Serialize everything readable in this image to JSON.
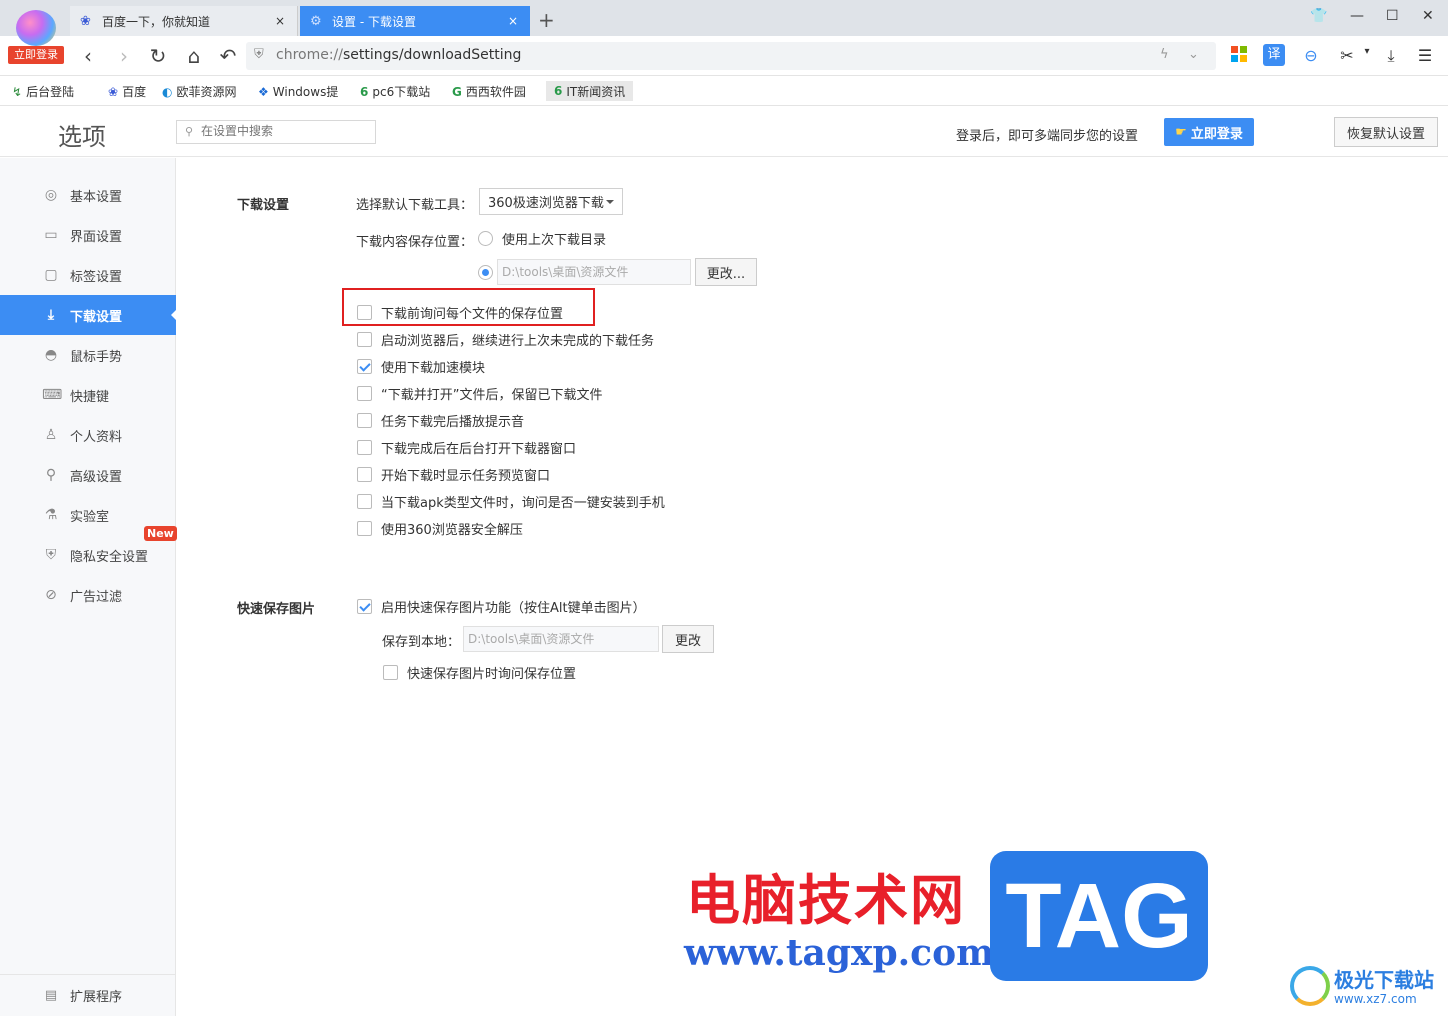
{
  "browser": {
    "login_badge": "立即登录",
    "tabs": [
      {
        "title": "百度一下，你就知道",
        "icon": "baidu-paw-icon",
        "close": "×"
      },
      {
        "title": "设置 - 下载设置",
        "icon": "gear-icon",
        "close": "×"
      }
    ],
    "new_tab": "+",
    "address": {
      "scheme": "chrome://",
      "host_path": "settings/downloadSetting"
    },
    "bookmarks": [
      {
        "label": "后台登陆",
        "icon_char": "↯"
      },
      {
        "label": "百度",
        "icon_char": "❀"
      },
      {
        "label": "欧菲资源网",
        "icon_char": "◐"
      },
      {
        "label": "Windows提",
        "icon_char": "❖"
      },
      {
        "label": "pc6下载站",
        "icon_char": "6"
      },
      {
        "label": "西西软件园",
        "icon_char": "G"
      },
      {
        "label": "IT新闻资讯",
        "icon_char": "6"
      }
    ],
    "toolbar_translate": "译"
  },
  "settings": {
    "title": "选项",
    "search_placeholder": "在设置中搜索",
    "login_tip": "登录后，即可多端同步您的设置",
    "login_button": "立即登录",
    "restore_button": "恢复默认设置",
    "sidebar": [
      {
        "label": "基本设置",
        "icon": "◎"
      },
      {
        "label": "界面设置",
        "icon": "▭"
      },
      {
        "label": "标签设置",
        "icon": "▢"
      },
      {
        "label": "下载设置",
        "icon": "⤓"
      },
      {
        "label": "鼠标手势",
        "icon": "◓"
      },
      {
        "label": "快捷键",
        "icon": "⌨"
      },
      {
        "label": "个人资料",
        "icon": "♙"
      },
      {
        "label": "高级设置",
        "icon": "⚲"
      },
      {
        "label": "实验室",
        "icon": "⚗"
      },
      {
        "label": "隐私安全设置",
        "icon": "⛨"
      },
      {
        "label": "广告过滤",
        "icon": "⊘"
      }
    ],
    "new_badge": "New",
    "extensions": {
      "label": "扩展程序",
      "icon": "▤"
    },
    "download": {
      "section_title": "下载设置",
      "tool_label": "选择默认下载工具：",
      "tool_value": "360极速浏览器下载",
      "location_label": "下载内容保存位置：",
      "use_last_dir": "使用上次下载目录",
      "custom_path": "D:\\tools\\桌面\\资源文件",
      "change_button": "更改...",
      "options": [
        {
          "label": "下载前询问每个文件的保存位置",
          "checked": false
        },
        {
          "label": "启动浏览器后，继续进行上次未完成的下载任务",
          "checked": false
        },
        {
          "label": "使用下载加速模块",
          "checked": true
        },
        {
          "label": "“下载并打开”文件后，保留已下载文件",
          "checked": false
        },
        {
          "label": "任务下载完后播放提示音",
          "checked": false
        },
        {
          "label": "下载完成后在后台打开下载器窗口",
          "checked": false
        },
        {
          "label": "开始下载时显示任务预览窗口",
          "checked": false
        },
        {
          "label": "当下载apk类型文件时，询问是否一键安装到手机",
          "checked": false
        },
        {
          "label": "使用360浏览器安全解压",
          "checked": false
        }
      ]
    },
    "quick_save": {
      "section_title": "快速保存图片",
      "enable_label": "启用快速保存图片功能（按住Alt键单击图片）",
      "enable_checked": true,
      "save_to_label": "保存到本地：",
      "save_path": "D:\\tools\\桌面\\资源文件",
      "change_button": "更改",
      "ask_label": "快速保存图片时询问保存位置",
      "ask_checked": false
    }
  },
  "watermark": {
    "site_cn": "电脑技术网",
    "site_url": "www.tagxp.com",
    "tag": "TAG",
    "corner_cn": "极光下载站",
    "corner_url": "www.xz7.com"
  }
}
